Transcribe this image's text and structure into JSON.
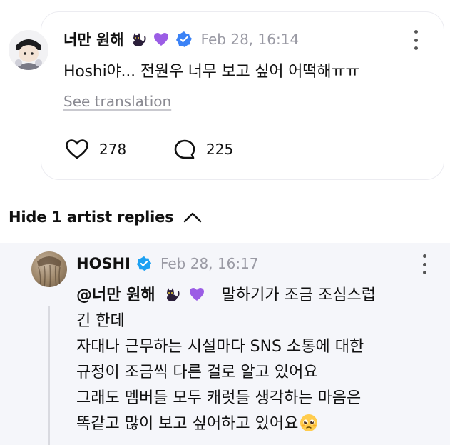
{
  "post": {
    "author": "너만 원해",
    "timestamp": "Feb 28, 16:14",
    "text": "Hoshi야... 전원우 너무 보고 싶어 어떡해ㅠㅠ",
    "see_translation": "See translation",
    "likes": "278",
    "comments": "225"
  },
  "replies_toggle": {
    "label": "Hide 1 artist replies"
  },
  "reply": {
    "author": "HOSHI",
    "timestamp": "Feb 28, 16:17",
    "mention": "@너만 원해",
    "first_line_text": "말하기가 조금 조심스럽",
    "lines": [
      "긴 한데",
      "자대나 근무하는 시설마다 SNS 소통에 대한",
      "규정이 조금씩 다른 걸로 알고 있어요",
      "그래도 멤버들 모두 캐럿들 생각하는 마음은",
      "똑같고 많이 보고 싶어하고 있어요"
    ]
  },
  "icons": {
    "cat": "black-cat-emoji",
    "heart": "purple-heart-emoji",
    "badge": "blue-check-badge-icon",
    "pleading": "pleading-face-emoji"
  },
  "colors": {
    "verified": "#1da1f2",
    "purple_heart": "#9b5de5",
    "reply_background": "#f5f6fa",
    "muted_text": "#9a9aa4"
  }
}
